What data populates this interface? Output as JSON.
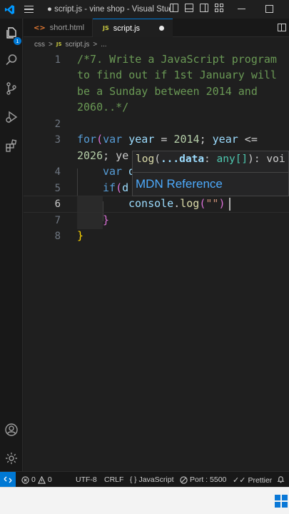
{
  "window": {
    "title": "● script.js - vine shop - Visual Studi..."
  },
  "activity_bar": {
    "explorer_badge": "1",
    "items": [
      "explorer-icon",
      "search-icon",
      "source-control-icon",
      "run-debug-icon",
      "extensions-icon"
    ],
    "bottom_items": [
      "account-icon",
      "settings-gear-icon"
    ]
  },
  "tabs": [
    {
      "label": "short.html",
      "icon": "html-file-icon",
      "active": false
    },
    {
      "label": "script.js",
      "icon": "js-file-icon",
      "active": true,
      "modified": true
    }
  ],
  "breadcrumb": {
    "folder": "css",
    "sep": ">",
    "file_icon": "JS",
    "file": "script.js",
    "more": "..."
  },
  "editor": {
    "line_numbers": [
      "1",
      "2",
      "3",
      "4",
      "5",
      "6",
      "7",
      "8"
    ],
    "current_line": "6",
    "code": {
      "l1a": "/*7. Write a JavaScript program",
      "l1b": "to find out if 1st January will",
      "l1c": "be a Sunday between 2014 and",
      "l1d": "2060..*/",
      "l3_for": "for",
      "l3_paren": "(",
      "l3_var": "var",
      "l3_year": "year",
      "l3_eq": " = ",
      "l3_num": "2014",
      "l3_semi": "; ",
      "l3_year2": "year",
      "l3_lte": " <=",
      "l3b_num": "2026",
      "l3b_rest": "; ye",
      "l4_var": "var",
      "l4_rest": " d",
      "l5_if": "if",
      "l5_paren": "(",
      "l5_rest": "d",
      "l6_console": "console",
      "l6_dot": ".",
      "l6_log": "log",
      "l6_paren": "(",
      "l6_str": "\"\"",
      "l6_close": ")",
      "l7_brace": "}",
      "l8_brace": "}"
    }
  },
  "hover": {
    "sig_fn": "log",
    "sig_open": "(",
    "sig_param": "...data",
    "sig_colon": ": ",
    "sig_type": "any[]",
    "sig_close": "): voi",
    "link": "MDN Reference"
  },
  "status_bar": {
    "remote_icon": "remote-icon",
    "errors": "0",
    "warnings": "0",
    "encoding": "UTF-8",
    "eol": "CRLF",
    "language_icon": "braces-icon",
    "language": "JavaScript",
    "port": "Port : 5500",
    "prettier": "Prettier",
    "bell_icon": "bell-icon"
  },
  "taskbar": {
    "start_icon": "windows-start-icon"
  },
  "colors": {
    "accent": "#0078d4",
    "comment": "#6a9955",
    "keyword": "#569cd6",
    "variable": "#9cdcfe",
    "number": "#b5cea8",
    "function": "#dcdcaa",
    "string": "#ce9178",
    "link": "#4daafc"
  }
}
